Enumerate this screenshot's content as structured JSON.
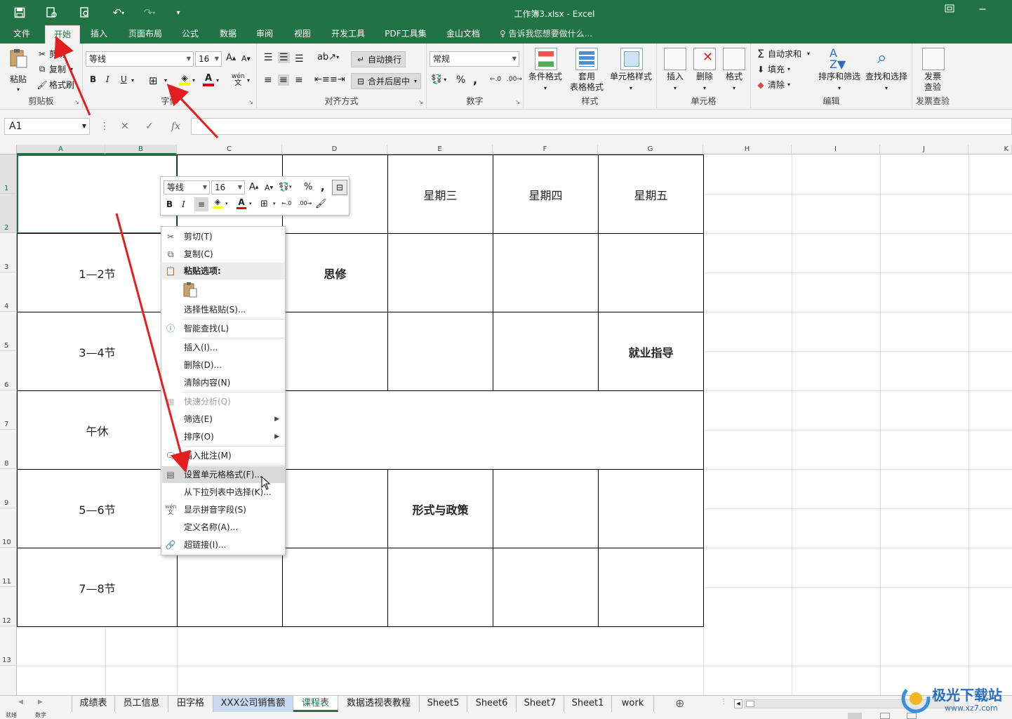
{
  "titlebar": {
    "title": "工作簿3.xlsx - Excel",
    "restore_icon": "restore-window-icon",
    "minimize": "─"
  },
  "menu": {
    "tabs": [
      "文件",
      "开始",
      "插入",
      "页面布局",
      "公式",
      "数据",
      "审阅",
      "视图",
      "开发工具",
      "PDF工具集",
      "金山文档"
    ],
    "tellme": "告诉我您想要做什么..."
  },
  "ribbon": {
    "clipboard": {
      "paste": "粘贴",
      "cut": "剪切",
      "copy": "复制",
      "format_painter": "格式刷",
      "label": "剪贴板"
    },
    "font": {
      "name": "等线",
      "size": "16",
      "bold": "B",
      "italic": "I",
      "underline": "U",
      "label": "字体",
      "wen": "wén",
      "wen_sub": "文"
    },
    "align": {
      "wrap": "自动换行",
      "merge": "合并后居中",
      "label": "对齐方式"
    },
    "number": {
      "format": "常规",
      "percent": "%",
      "comma": ",",
      "label": "数字"
    },
    "styles": {
      "cond": "条件格式",
      "table1": "套用",
      "table2": "表格格式",
      "cell": "单元格样式",
      "label": "样式"
    },
    "cells": {
      "insert": "插入",
      "delete": "删除",
      "format": "格式",
      "label": "单元格"
    },
    "edit": {
      "autosum": "自动求和",
      "fill": "填充",
      "clear": "清除",
      "sort": "排序和筛选",
      "find": "查找和选择",
      "label": "编辑"
    },
    "invoice": {
      "check1": "发票",
      "check2": "查验",
      "label": "发票查验"
    }
  },
  "formula_bar": {
    "namebox": "A1",
    "cancel": "✕",
    "confirm": "✓",
    "fx": "fx"
  },
  "columns": [
    "A",
    "B",
    "C",
    "D",
    "E",
    "F",
    "G",
    "H",
    "I",
    "J",
    "K"
  ],
  "rows": [
    "1",
    "2",
    "3",
    "4",
    "5",
    "6",
    "7",
    "8",
    "9",
    "10",
    "11",
    "12",
    "13"
  ],
  "cells": {
    "e1": "星期三",
    "f1": "星期四",
    "g1": "星期五",
    "a3": "1—2节",
    "d3": "思修",
    "a5": "3—4节",
    "g5": "就业指导",
    "a7": "午休",
    "a9": "5—6节",
    "e9": "形式与政策",
    "a11": "7—8节"
  },
  "mini_toolbar": {
    "font": "等线",
    "size": "16",
    "bold": "B",
    "italic": "I",
    "percent": "%",
    "comma": ",",
    "font_color": "A"
  },
  "context_menu": [
    {
      "label": "剪切(T)",
      "icon": "scissors-icon"
    },
    {
      "label": "复制(C)",
      "icon": "copy-icon"
    },
    {
      "label": "粘贴选项:",
      "icon": "paste-icon"
    },
    {
      "label": "选择性粘贴(S)...",
      "icon": ""
    },
    {
      "label": "智能查找(L)",
      "icon": "smart-lookup-icon"
    },
    {
      "label": "插入(I)...",
      "icon": ""
    },
    {
      "label": "删除(D)...",
      "icon": ""
    },
    {
      "label": "清除内容(N)",
      "icon": ""
    },
    {
      "label": "快速分析(Q)",
      "icon": "quick-analysis-icon"
    },
    {
      "label": "筛选(E)",
      "icon": ""
    },
    {
      "label": "排序(O)",
      "icon": ""
    },
    {
      "label": "插入批注(M)",
      "icon": "comment-icon"
    },
    {
      "label": "设置单元格格式(F)...",
      "icon": "format-cells-icon"
    },
    {
      "label": "从下拉列表中选择(K)...",
      "icon": ""
    },
    {
      "label": "显示拼音字段(S)",
      "icon": "phonetic-icon"
    },
    {
      "label": "定义名称(A)...",
      "icon": ""
    },
    {
      "label": "超链接(I)...",
      "icon": "hyperlink-icon"
    }
  ],
  "sheet_tabs": [
    "成绩表",
    "员工信息",
    "田字格",
    "XXX公司销售额",
    "课程表",
    "数据透视表教程",
    "Sheet5",
    "Sheet6",
    "Sheet7",
    "Sheet1",
    "work"
  ],
  "status": {
    "ready": "就绪",
    "num": "数字"
  },
  "watermark": {
    "brand": "极光下载站",
    "url": "www.xz7.com"
  },
  "accent": "#217346",
  "arrow_color": "#e41e1e"
}
